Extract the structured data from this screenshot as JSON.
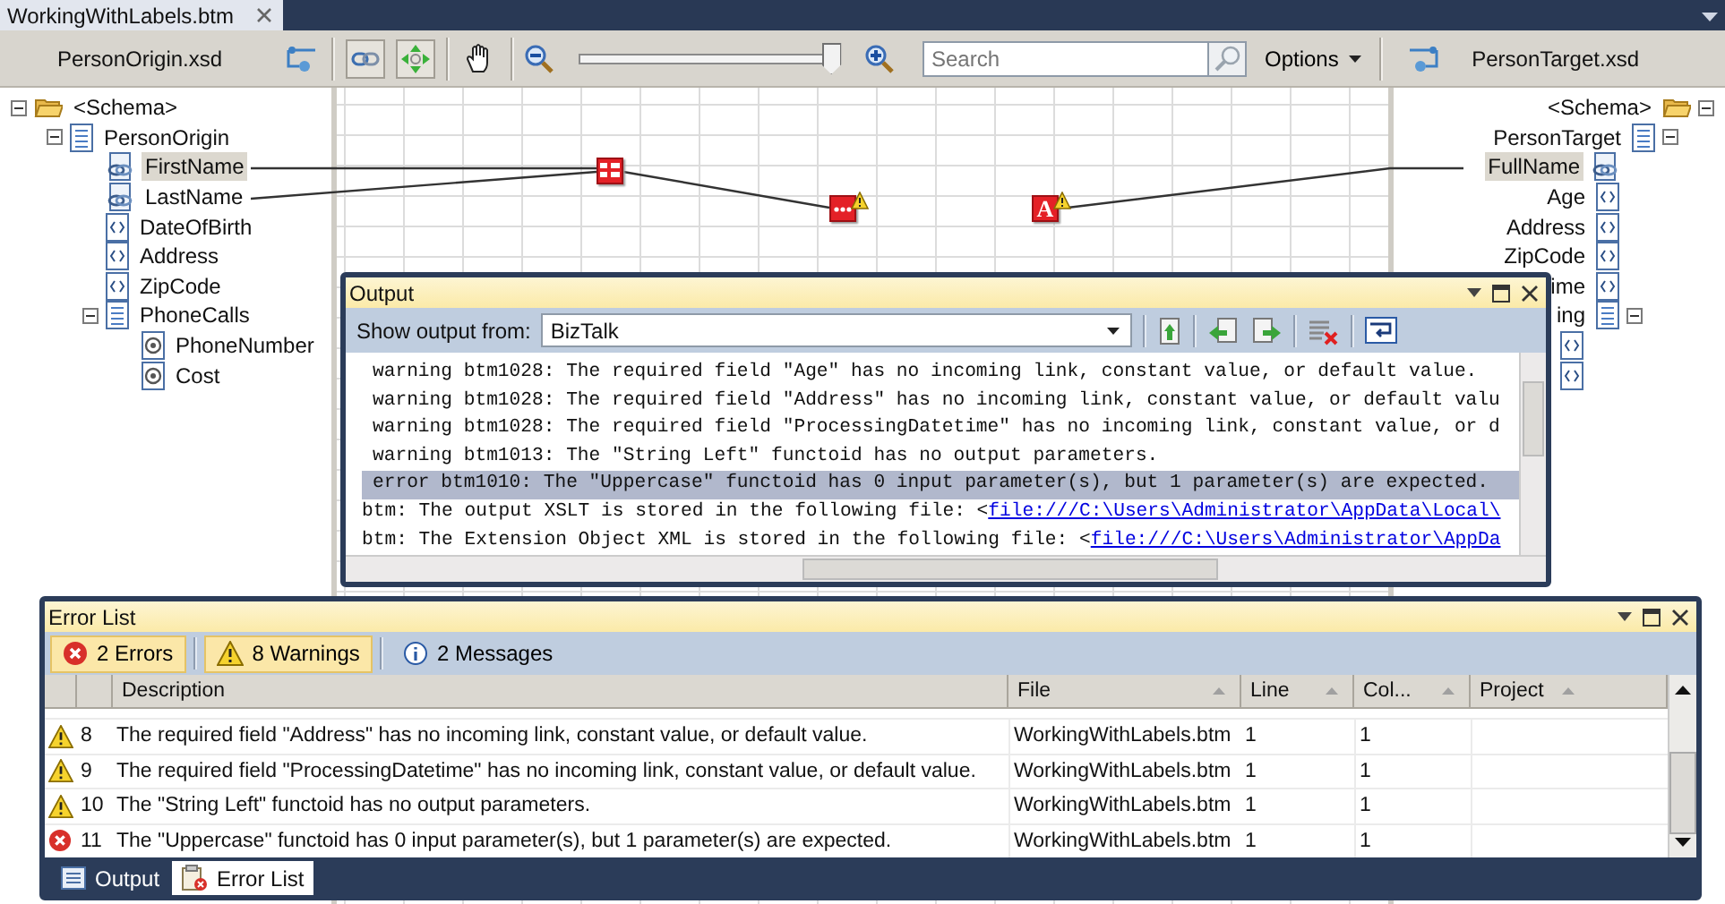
{
  "document_tab": {
    "title": "WorkingWithLabels.btm",
    "selected": true
  },
  "toolbar": {
    "tools": [
      {
        "kind": "link",
        "pressed": true
      },
      {
        "kind": "autoscroll",
        "pressed": true
      },
      {
        "kind": "hand",
        "pressed": false
      }
    ],
    "zoom": {
      "level": 0.97
    },
    "search": {
      "placeholder": "Search"
    },
    "options_button": "Options"
  },
  "source_schema": {
    "file": "PersonOrigin.xsd",
    "tree": [
      {
        "label": "<Schema>",
        "kind": "folder",
        "expanded": true,
        "selected": false,
        "children": [
          {
            "label": "PersonOrigin",
            "kind": "record",
            "expanded": true,
            "selected": false,
            "children": [
              {
                "label": "FirstName",
                "kind": "linked",
                "selected": true
              },
              {
                "label": "LastName",
                "kind": "linked",
                "selected": false
              },
              {
                "label": "DateOfBirth",
                "kind": "field",
                "selected": false
              },
              {
                "label": "Address",
                "kind": "field",
                "selected": false
              },
              {
                "label": "ZipCode",
                "kind": "field",
                "selected": false
              },
              {
                "label": "PhoneCalls",
                "kind": "record",
                "expanded": true,
                "selected": false,
                "children": [
                  {
                    "label": "PhoneNumber",
                    "kind": "attribute",
                    "selected": false
                  },
                  {
                    "label": "Cost",
                    "kind": "attribute",
                    "selected": false
                  }
                ]
              }
            ]
          }
        ]
      }
    ]
  },
  "target_schema": {
    "file": "PersonTarget.xsd",
    "tree": [
      {
        "label": "<Schema>",
        "kind": "folder",
        "expanded": true,
        "selected": false,
        "children": [
          {
            "label": "PersonTarget",
            "kind": "record",
            "expanded": true,
            "selected": false,
            "children": [
              {
                "label": "FullName",
                "kind": "linked",
                "selected": true
              },
              {
                "label": "Age",
                "kind": "field",
                "selected": false
              },
              {
                "label": "Address",
                "kind": "field",
                "selected": false
              },
              {
                "label": "ZipCode",
                "kind": "field",
                "selected": false
              },
              {
                "label": "ime",
                "kind": "field",
                "selected": false
              },
              {
                "label": "ing",
                "kind": "record",
                "expanded": true,
                "selected": false,
                "children": [
                  {
                    "kind": "field"
                  },
                  {
                    "kind": "field"
                  }
                ]
              }
            ]
          }
        ]
      }
    ]
  },
  "functoids": [
    {
      "kind": "table",
      "warning": false
    },
    {
      "kind": "concat",
      "warning": true
    },
    {
      "kind": "letter",
      "label": "A",
      "warning": true
    }
  ],
  "output": {
    "title": "Output",
    "source_label": "Show output from:",
    "source": "BizTalk",
    "lines": [
      {
        "kind": "warning",
        "selected": false,
        "text": "warning btm1028: The required field \"Age\" has no incoming link, constant value, or default value."
      },
      {
        "kind": "warning",
        "selected": false,
        "text": "warning btm1028: The required field \"Address\" has no incoming link, constant value, or default valu"
      },
      {
        "kind": "warning",
        "selected": false,
        "text": "warning btm1028: The required field \"ProcessingDatetime\" has no incoming link, constant value, or d"
      },
      {
        "kind": "warning",
        "selected": false,
        "text": "warning btm1013: The \"String Left\" functoid has no output parameters."
      },
      {
        "kind": "error",
        "selected": true,
        "text": "error btm1010: The \"Uppercase\" functoid has 0 input parameter(s), but 1 parameter(s) are expected."
      },
      {
        "kind": "info",
        "selected": false,
        "text": "btm: The output XSLT is stored in the following file: <",
        "link": "file:///C:\\Users\\Administrator\\AppData\\Local\\"
      },
      {
        "kind": "info",
        "selected": false,
        "text": "btm: The Extension Object XML is stored in the following file: <",
        "link": "file:///C:\\Users\\Administrator\\AppDa"
      }
    ]
  },
  "error_list": {
    "title": "Error List",
    "filters": [
      {
        "kind": "error",
        "label": "2 Errors",
        "selected": true
      },
      {
        "kind": "warning",
        "label": "8 Warnings",
        "selected": true
      },
      {
        "kind": "message",
        "label": "2 Messages",
        "selected": false
      }
    ],
    "columns": [
      "Description",
      "File",
      "Line",
      "Col...",
      "Project"
    ],
    "rows": [
      {
        "kind": "warning",
        "number": "8",
        "description": "The required field \"Address\" has no incoming link, constant value, or default value.",
        "file": "WorkingWithLabels.btm",
        "line": "1",
        "column": "1"
      },
      {
        "kind": "warning",
        "number": "9",
        "description": "The required field \"ProcessingDatetime\" has no incoming link, constant value, or default value.",
        "file": "WorkingWithLabels.btm",
        "line": "1",
        "column": "1"
      },
      {
        "kind": "warning",
        "number": "10",
        "description": "The \"String Left\" functoid has no output parameters.",
        "file": "WorkingWithLabels.btm",
        "line": "1",
        "column": "1"
      },
      {
        "kind": "error",
        "number": "11",
        "description": "The \"Uppercase\" functoid has 0 input parameter(s), but 1 parameter(s) are expected.",
        "file": "WorkingWithLabels.btm",
        "line": "1",
        "column": "1"
      }
    ]
  },
  "bottom_tabs": [
    {
      "kind": "output",
      "label": "Output",
      "selected": false
    },
    {
      "kind": "errors",
      "label": "Error List",
      "selected": true
    }
  ]
}
